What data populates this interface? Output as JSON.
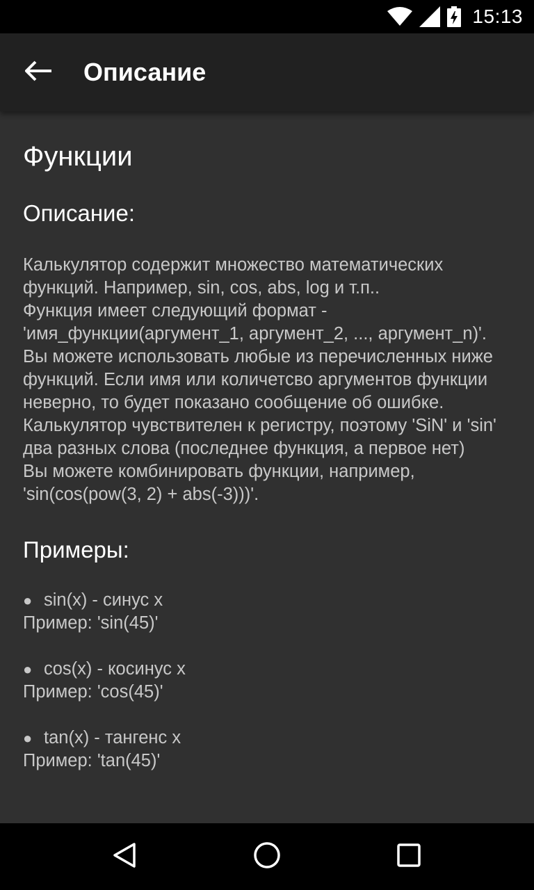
{
  "status_bar": {
    "time": "15:13",
    "icons": [
      "wifi-icon",
      "signal-icon",
      "battery-charging-icon"
    ]
  },
  "app_bar": {
    "back_icon": "arrow-left-icon",
    "title": "Описание"
  },
  "content": {
    "section_title": "Функции",
    "description_title": "Описание:",
    "description_paragraphs": [
      "Калькулятор содержит множество математических функций. Например, sin, cos, abs, log и т.п..",
      "Функция имеет следующий формат - 'имя_функции(аргумент_1, аргумент_2, ..., аргумент_n)'.",
      "Вы можете использовать любые из перечисленных ниже функций. Если имя или количетсво аргументов функции неверно, то будет показано сообщение об ошибке.",
      "Калькулятор чувствителен к регистру, поэтому 'SiN' и 'sin' два разных слова (последнее функция, а первое нет)",
      "Вы можете комбинировать функции, например, 'sin(cos(pow(3, 2) + abs(-3)))'."
    ],
    "examples_title": "Примеры:",
    "examples": [
      {
        "bullet": "●",
        "name": "sin(x) - синус x",
        "example": "Пример: 'sin(45)'"
      },
      {
        "bullet": "●",
        "name": "cos(x) - косинус x",
        "example": "Пример: 'cos(45)'"
      },
      {
        "bullet": "●",
        "name": "tan(x) - тангенс x",
        "example": "Пример: 'tan(45)'"
      }
    ]
  },
  "nav_bar": {
    "buttons": [
      "back-triangle-icon",
      "home-circle-icon",
      "recents-square-icon"
    ]
  },
  "colors": {
    "status_bar": "#000000",
    "app_bar": "#212121",
    "background": "#303030",
    "heading_text": "#ffffff",
    "body_text": "#c8c8c8"
  }
}
